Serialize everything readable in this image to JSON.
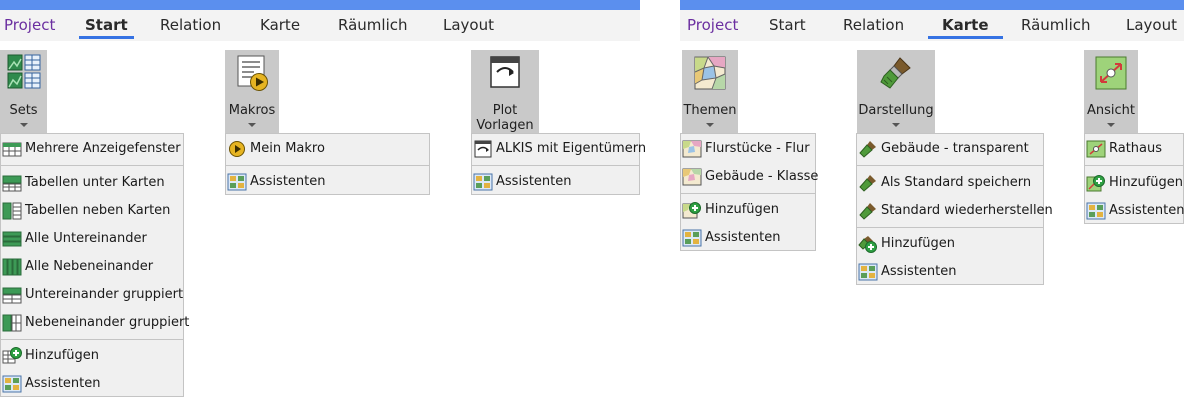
{
  "left": {
    "tabs": [
      "Project",
      "Start",
      "Relation",
      "Karte",
      "Räumlich",
      "Layout"
    ],
    "active_tab": "Start",
    "groups": {
      "sets": {
        "label": "Sets",
        "icon": "sets-grid-icon",
        "items": [
          "Mehrere Anzeigefenster",
          "Tabellen unter Karten",
          "Tabellen neben Karten",
          "Alle Untereinander",
          "Alle Nebeneinander",
          "Untereinander gruppiert",
          "Nebeneinander gruppiert",
          "Hinzufügen",
          "Assistenten"
        ]
      },
      "makros": {
        "label": "Makros",
        "icon": "macro-play-icon",
        "items": [
          "Mein Makro",
          "Assistenten"
        ]
      },
      "plot": {
        "label_line1": "Plot",
        "label_line2": "Vorlagen",
        "icon": "plot-template-icon",
        "items": [
          "ALKIS mit Eigentümern",
          "Assistenten"
        ]
      }
    }
  },
  "right": {
    "tabs": [
      "Project",
      "Start",
      "Relation",
      "Karte",
      "Räumlich",
      "Layout"
    ],
    "active_tab": "Karte",
    "groups": {
      "themen": {
        "label": "Themen",
        "icon": "theme-map-icon",
        "items": [
          "Flurstücke - Flur",
          "Gebäude - Klasse",
          "Hinzufügen",
          "Assistenten"
        ]
      },
      "darstellung": {
        "label": "Darstellung",
        "icon": "paintbrush-icon",
        "items": [
          "Gebäude - transparent",
          "Als Standard speichern",
          "Standard wiederherstellen",
          "Hinzufügen",
          "Assistenten"
        ]
      },
      "ansicht": {
        "label": "Ansicht",
        "icon": "zoom-extent-icon",
        "items": [
          "Rathaus",
          "Hinzufügen",
          "Assistenten"
        ]
      }
    }
  },
  "colors": {
    "accent": "#3572e3",
    "topbar": "#5b8fee",
    "project": "#6b2fa0",
    "button_bg": "#c9c9c9",
    "menu_bg": "#f0f0f0"
  }
}
